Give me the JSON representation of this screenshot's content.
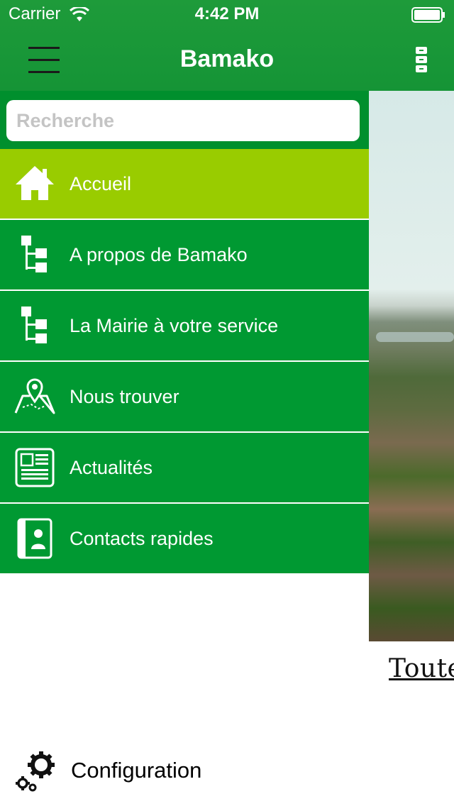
{
  "status_bar": {
    "carrier": "Carrier",
    "time": "4:42 PM"
  },
  "nav": {
    "title": "Bamako",
    "menu_icon": "hamburger-menu-icon",
    "right_icon": "options-icon"
  },
  "search": {
    "placeholder": "Recherche",
    "value": ""
  },
  "menu": {
    "items": [
      {
        "label": "Accueil",
        "icon": "home-icon",
        "active": true
      },
      {
        "label": "A propos de Bamako",
        "icon": "sitemap-icon",
        "active": false
      },
      {
        "label": "La Mairie à votre service",
        "icon": "sitemap-icon",
        "active": false
      },
      {
        "label": "Nous trouver",
        "icon": "map-pin-icon",
        "active": false
      },
      {
        "label": "Actualités",
        "icon": "newspaper-icon",
        "active": false
      },
      {
        "label": "Contacts rapides",
        "icon": "contact-book-icon",
        "active": false
      }
    ]
  },
  "config": {
    "label": "Configuration",
    "icon": "gears-icon"
  },
  "background": {
    "caption": "Toute l"
  },
  "colors": {
    "primary": "#009932",
    "active": "#99cc00",
    "header": "#1e9b3a"
  }
}
